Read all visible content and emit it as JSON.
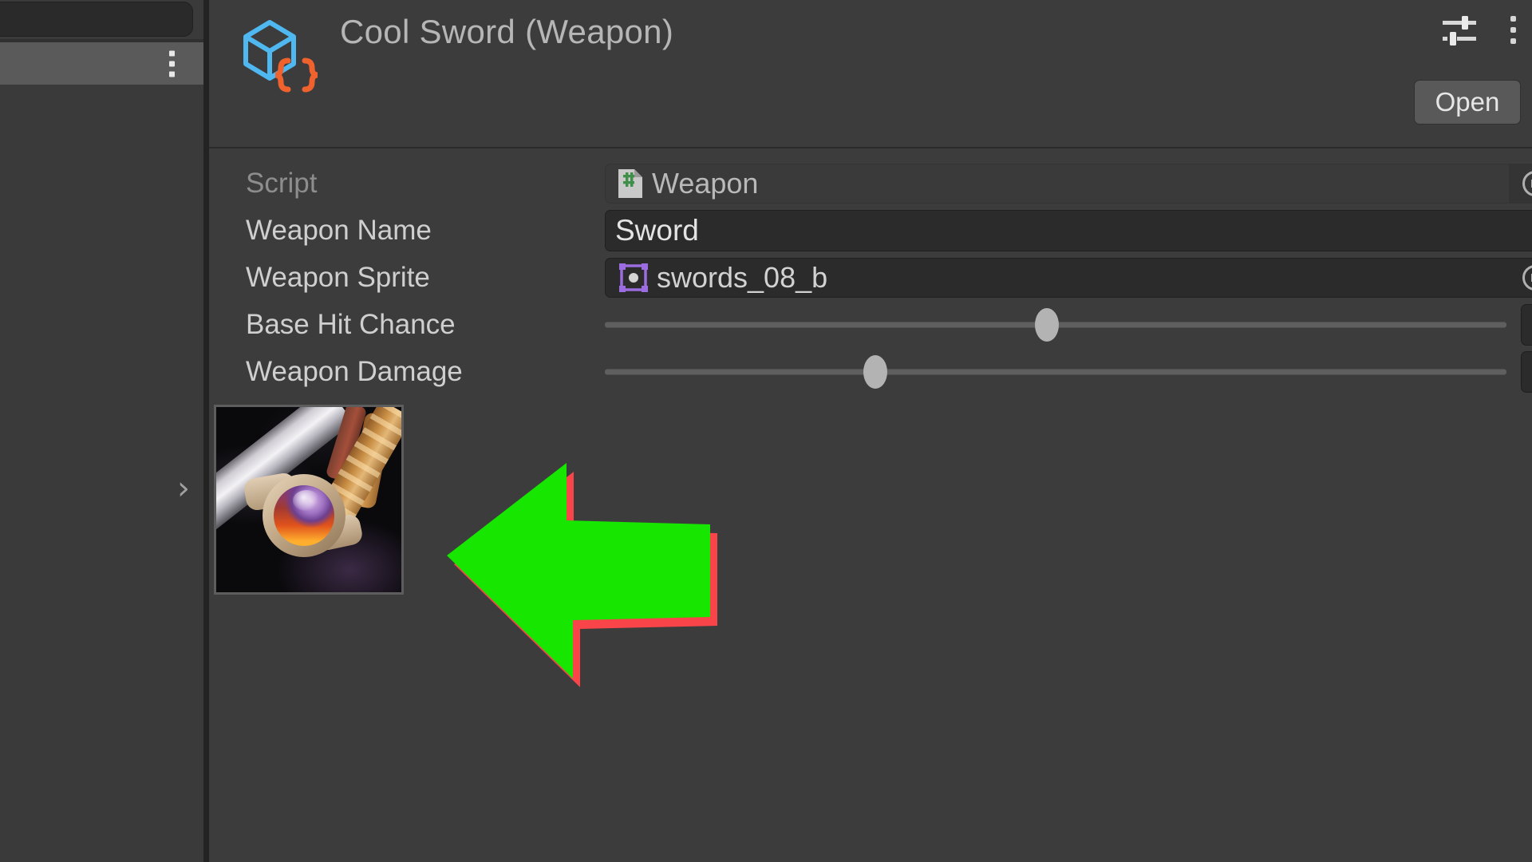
{
  "app": "Unity Editor Inspector",
  "sidebar": {
    "search_placeholder": "",
    "selected_row_label": "",
    "kebab_icon": "kebab-menu-icon",
    "expand_chevron": "›"
  },
  "inspector": {
    "header": {
      "title": "Cool Sword (Weapon)",
      "asset_icon": "scriptable-object-icon",
      "preset_icon": "preset-sliders-icon",
      "kebab_icon": "kebab-menu-icon",
      "open_button_label": "Open"
    },
    "fields": [
      {
        "label": "Script",
        "type": "object",
        "value": "Weapon",
        "icon": "cs-script-icon",
        "readonly": true,
        "picker_icon": "object-picker-icon"
      },
      {
        "label": "Weapon Name",
        "type": "text",
        "value": "Sword",
        "placeholder": ""
      },
      {
        "label": "Weapon Sprite",
        "type": "object",
        "value": "swords_08_b",
        "icon": "sprite-icon",
        "readonly": false,
        "picker_icon": "object-picker-icon"
      },
      {
        "label": "Base Hit Chance",
        "type": "slider",
        "value": "0.5",
        "fill_percent": 49
      },
      {
        "label": "Weapon Damage",
        "type": "slider",
        "value": "3",
        "fill_percent": 30
      }
    ],
    "preview": {
      "name": "sprite-preview-thumbnail",
      "alt": "swords_08_b"
    }
  },
  "annotation": {
    "name": "green-left-arrow",
    "direction": "left",
    "fill_color": "#16e600",
    "shadow_color": "#f9444a"
  },
  "colors": {
    "panel_bg": "#3c3c3c",
    "sidebar_bg": "#3a3a3a",
    "input_bg": "#2b2b2b",
    "label_text": "#cfcfcf",
    "dim_text": "#8d8d8d",
    "accent_blue": "#4fb8f0",
    "accent_orange": "#f0622d",
    "sprite_purple": "#9b6de0",
    "script_green": "#3f8f4a"
  }
}
